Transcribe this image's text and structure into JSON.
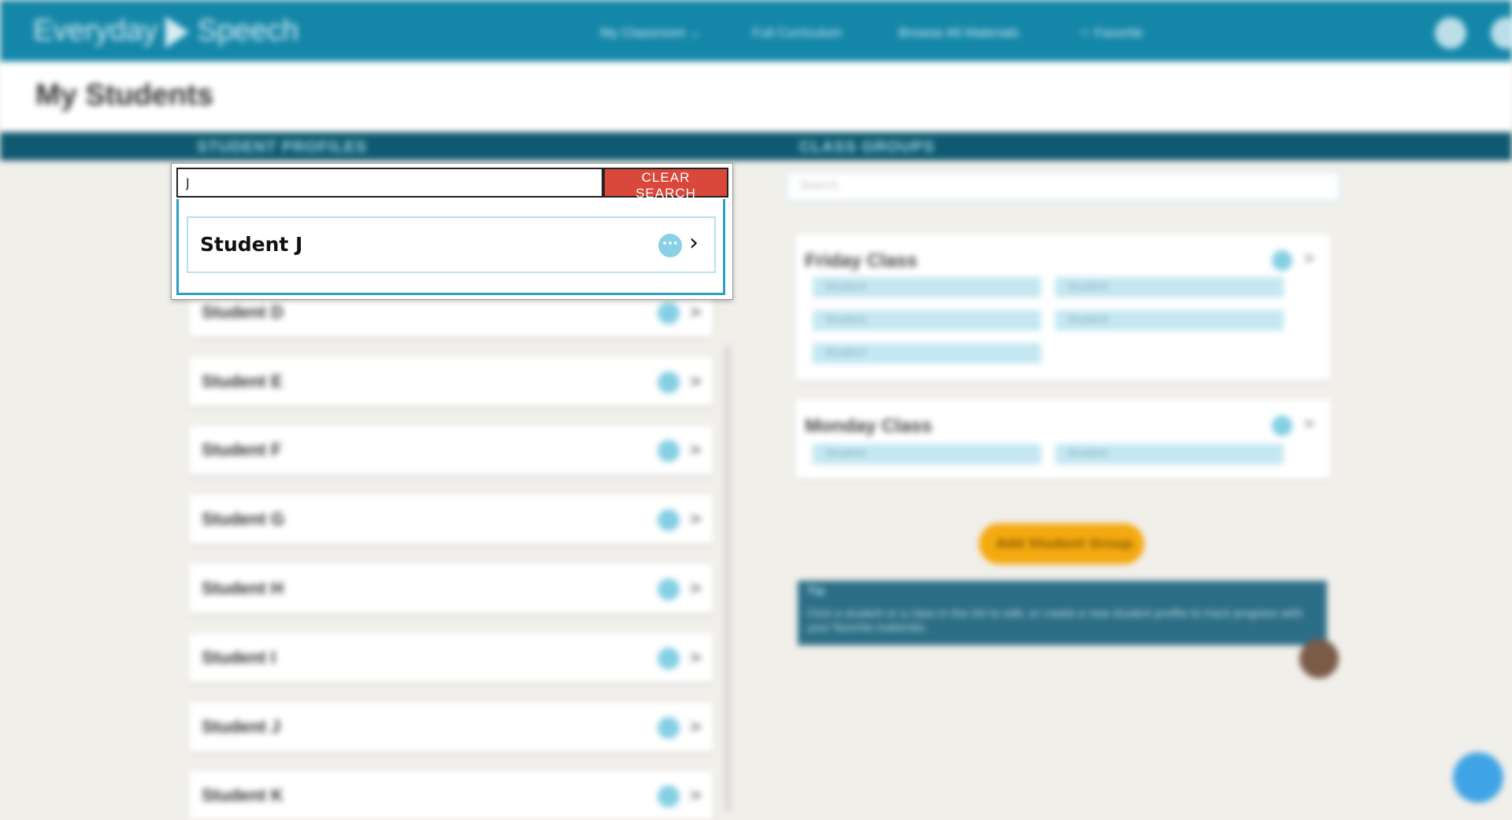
{
  "header": {
    "logo_text_left": "Everyday",
    "logo_text_right": "Speech",
    "nav": [
      {
        "label": "My Classroom ⌄"
      },
      {
        "label": "Full Curriculum"
      },
      {
        "label": "Browse All Materials"
      },
      {
        "label": "☆ Favorite"
      }
    ],
    "icons": [
      "help-icon",
      "account-icon"
    ]
  },
  "page": {
    "title": "My Students"
  },
  "sections": {
    "students_label": "STUDENT PROFILES",
    "classes_label": "CLASS GROUPS"
  },
  "search": {
    "value": "J",
    "clear_label": "CLEAR SEARCH",
    "results": [
      {
        "name": "Student J"
      }
    ]
  },
  "students_list": [
    {
      "name": "Student D"
    },
    {
      "name": "Student E"
    },
    {
      "name": "Student F"
    },
    {
      "name": "Student G"
    },
    {
      "name": "Student H"
    },
    {
      "name": "Student I"
    },
    {
      "name": "Student J"
    },
    {
      "name": "Student K"
    }
  ],
  "classes": {
    "search_placeholder": "Search",
    "groups": [
      {
        "name": "Friday Class",
        "members": [
          "Student",
          "Student",
          "Student",
          "Student",
          "Student"
        ]
      },
      {
        "name": "Monday Class",
        "members": [
          "Student",
          "Student"
        ]
      }
    ],
    "add_button": "Add Student Group",
    "tip_title": "Tip",
    "tip_text": "Click a student or a class in the list to edit, or create a new student profile to track progress with your favorite materials."
  },
  "colors": {
    "header_bg": "#1486a8",
    "section_bar": "#0f5a70",
    "clear_button": "#d9483b",
    "focus_border": "#2d9fc6",
    "add_button": "#f4a90f"
  }
}
